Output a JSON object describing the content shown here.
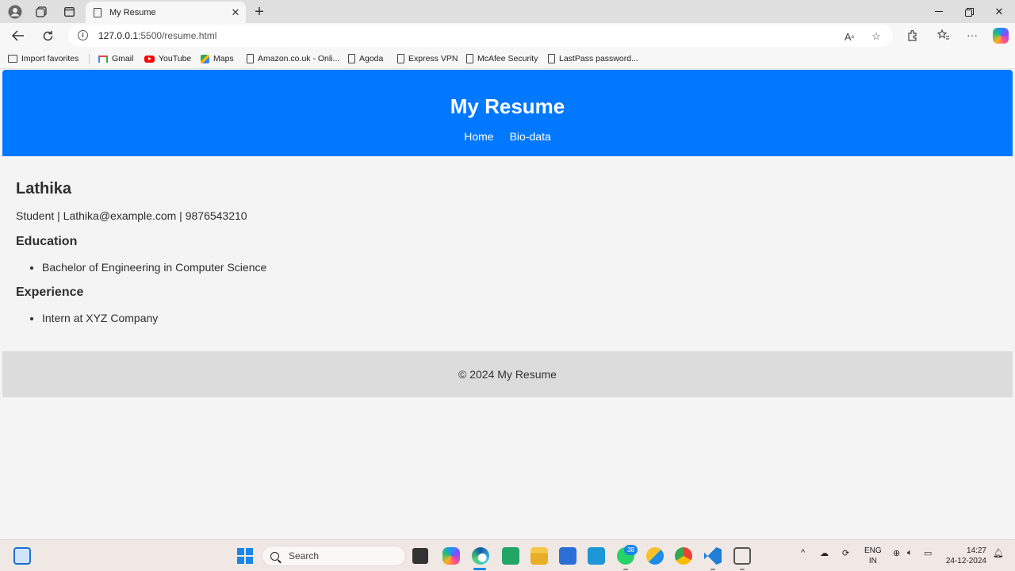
{
  "browser": {
    "tab_title": "My Resume",
    "url_host": "127.0.0.1",
    "url_rest": ":5500/resume.html"
  },
  "favorites": [
    {
      "label": "Import favorites",
      "icon": "import-icon"
    },
    {
      "label": "Gmail",
      "icon": "gmail-icon"
    },
    {
      "label": "YouTube",
      "icon": "youtube-icon"
    },
    {
      "label": "Maps",
      "icon": "maps-icon"
    },
    {
      "label": "Amazon.co.uk - Onli...",
      "icon": "page-icon"
    },
    {
      "label": "Agoda",
      "icon": "page-icon"
    },
    {
      "label": "Express VPN",
      "icon": "page-icon"
    },
    {
      "label": "McAfee Security",
      "icon": "page-icon"
    },
    {
      "label": "LastPass password...",
      "icon": "page-icon"
    }
  ],
  "site": {
    "title": "My Resume",
    "nav": [
      "Home",
      "Bio-data"
    ],
    "accent_color": "#0078ff"
  },
  "resume": {
    "name": "Lathika",
    "contact": "Student | Lathika@example.com | 9876543210",
    "education_heading": "Education",
    "education_items": [
      "Bachelor of Engineering in Computer Science"
    ],
    "experience_heading": "Experience",
    "experience_items": [
      "Intern at XYZ Company"
    ]
  },
  "footer": {
    "text": "© 2024 My Resume"
  },
  "taskbar": {
    "search_placeholder": "Search",
    "whatsapp_badge": "38",
    "lang_line1": "ENG",
    "lang_line2": "IN",
    "time": "14:27",
    "date": "24-12-2024"
  }
}
